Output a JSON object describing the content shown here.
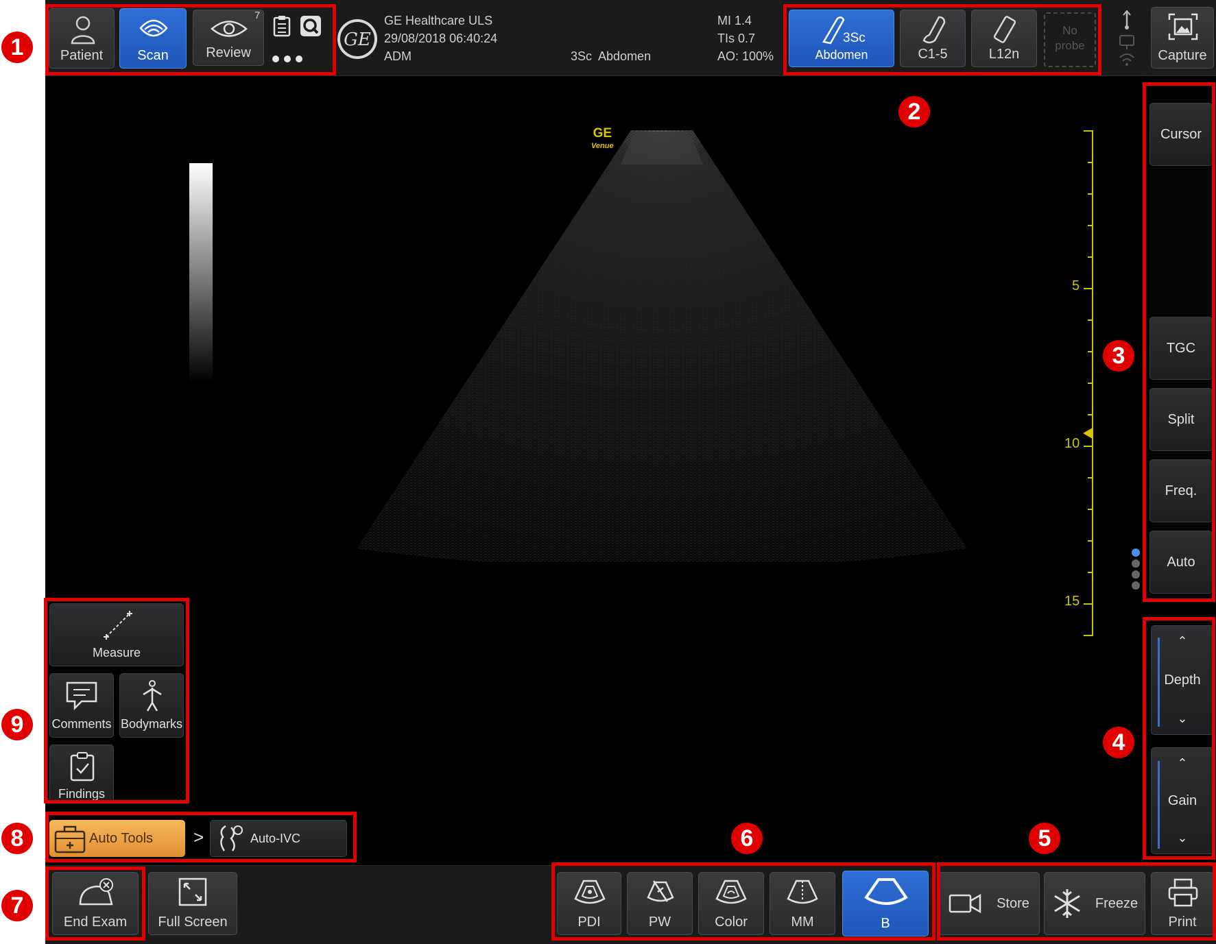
{
  "toolbar": {
    "patient_label": "Patient",
    "scan_label": "Scan",
    "review_label": "Review",
    "review_count": "7"
  },
  "header": {
    "institution": "GE Healthcare ULS",
    "datetime": "29/08/2018 06:40:24",
    "user": "ADM",
    "probe_preset": "3Sc  Abdomen",
    "mi": "MI 1.4",
    "tis": "TIs 0.7",
    "ao": "AO: 100%"
  },
  "probes": {
    "active_name": "3Sc",
    "active_preset": "Abdomen",
    "probe2": "C1-5",
    "probe3": "L12n",
    "empty_line1": "No",
    "empty_line2": "probe",
    "capture_label": "Capture"
  },
  "image": {
    "logo_line1": "GE",
    "logo_line2": "Venue",
    "depth_labels": [
      "5",
      "10",
      "15"
    ]
  },
  "side_menu": {
    "cursor": "Cursor",
    "tgc": "TGC",
    "split": "Split",
    "freq": "Freq.",
    "auto": "Auto"
  },
  "controls": {
    "depth": "Depth",
    "gain": "Gain"
  },
  "tools": {
    "measure": "Measure",
    "comments": "Comments",
    "bodymarks": "Bodymarks",
    "findings": "Findings"
  },
  "auto_tools": {
    "label": "Auto Tools",
    "separator": ">",
    "ivc": "Auto-IVC"
  },
  "bottom": {
    "end_exam": "End Exam",
    "full_screen": "Full Screen",
    "modes": [
      "PDI",
      "PW",
      "Color",
      "MM",
      "B"
    ],
    "store": "Store",
    "freeze": "Freeze",
    "print": "Print"
  },
  "markers": [
    "1",
    "2",
    "3",
    "4",
    "5",
    "6",
    "7",
    "8",
    "9"
  ],
  "colors": {
    "highlight_red": "#e10000",
    "active_blue": "#2563c8",
    "depth_scale_yellow": "#c8c800",
    "auto_tools_orange": "#f0a040"
  }
}
